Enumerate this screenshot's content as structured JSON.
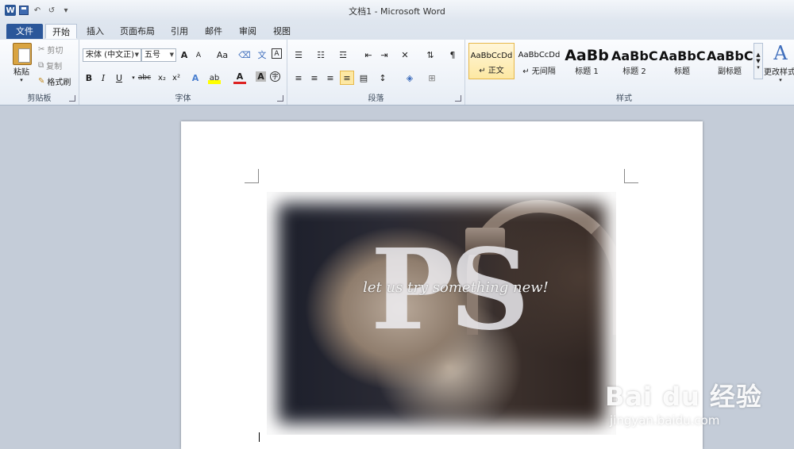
{
  "window": {
    "title": "文档1 - Microsoft Word"
  },
  "qat": {
    "undo": "↶",
    "redo": "↺",
    "more": "▾"
  },
  "tabs": [
    "文件",
    "开始",
    "插入",
    "页面布局",
    "引用",
    "邮件",
    "审阅",
    "视图"
  ],
  "clipboard": {
    "paste": "粘贴",
    "cut": "剪切",
    "copy": "复制",
    "format_painter": "格式刷",
    "label": "剪贴板"
  },
  "font": {
    "font_name": "宋体 (中文正)",
    "font_size": "五号",
    "grow": "A",
    "shrink": "A",
    "case": "Aa",
    "clear": "A",
    "bold": "B",
    "italic": "I",
    "underline": "U",
    "strike": "abc",
    "subscript": "x₂",
    "superscript": "x²",
    "label": "字体"
  },
  "paragraph": {
    "label": "段落"
  },
  "styles": {
    "items": [
      {
        "sample": "AaBbCcDd",
        "name": "↵ 正文"
      },
      {
        "sample": "AaBbCcDd",
        "name": "↵ 无间隔"
      },
      {
        "sample": "AaBb",
        "name": "标题 1"
      },
      {
        "sample": "AaBbC",
        "name": "标题 2"
      },
      {
        "sample": "AaBbC",
        "name": "标题"
      },
      {
        "sample": "AaBbC",
        "name": "副标题"
      }
    ],
    "change": "更改样式",
    "label": "样式"
  },
  "document": {
    "image_text_large": "PS",
    "image_tagline": "let us try something new!"
  },
  "watermark": {
    "logo": "Bai du 经验",
    "url": "jingyan.baidu.com"
  },
  "colors": {
    "file_tab": "#2b579a",
    "style_selected": "#fde8a3"
  }
}
